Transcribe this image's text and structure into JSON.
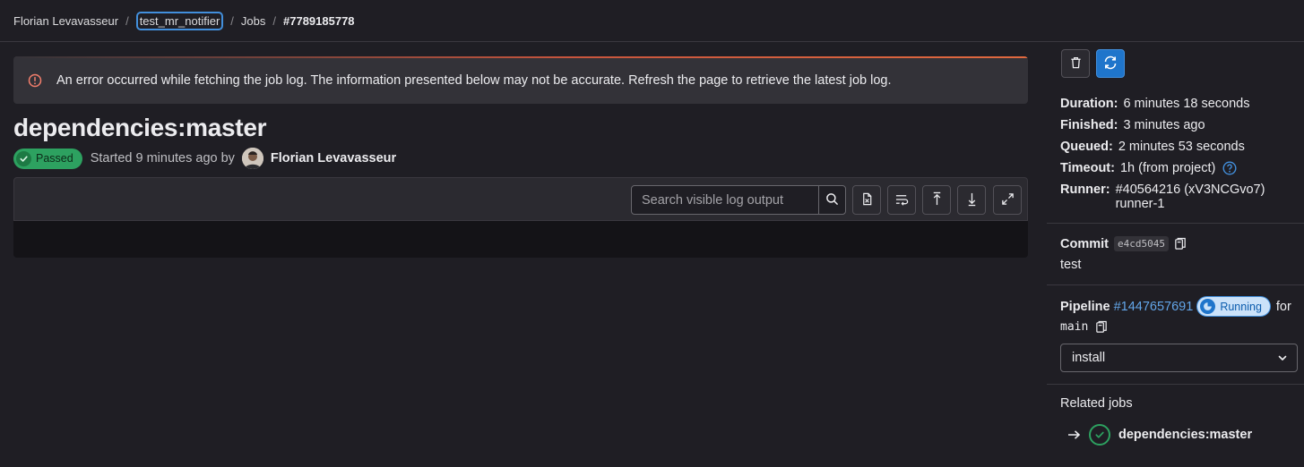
{
  "breadcrumb": {
    "items": [
      "Florian Levavasseur",
      "test_mr_notifier",
      "Jobs",
      "#7789185778"
    ],
    "separator": "/"
  },
  "alert": {
    "message": "An error occurred while fetching the job log. The information presented below may not be accurate. Refresh the page to retrieve the latest job log.",
    "icon": "error-circle-icon"
  },
  "job": {
    "title": "dependencies:master",
    "status": "Passed",
    "started_text": "Started 9 minutes ago by",
    "author": "Florian Levavasseur"
  },
  "log_toolbar": {
    "search_placeholder": "Search visible log output",
    "icons": [
      "search-icon",
      "raw-log-icon",
      "wrap-lines-icon",
      "scroll-to-top-icon",
      "scroll-to-bottom-icon",
      "fullscreen-icon"
    ]
  },
  "sidebar": {
    "actions": {
      "delete_icon": "trash-icon",
      "retry_icon": "retry-icon"
    },
    "details": [
      {
        "key": "Duration:",
        "value": "6 minutes 18 seconds"
      },
      {
        "key": "Finished:",
        "value": "3 minutes ago"
      },
      {
        "key": "Queued:",
        "value": "2 minutes 53 seconds"
      },
      {
        "key": "Timeout:",
        "value": "1h (from project)"
      },
      {
        "key": "Runner:",
        "value": "#40564216 (xV3NCGvo7)",
        "value2": "runner-1"
      }
    ],
    "commit": {
      "label": "Commit",
      "sha": "e4cd5045",
      "message": "test"
    },
    "pipeline": {
      "label": "Pipeline",
      "id": "#1447657691",
      "status": "Running",
      "for_text": "for",
      "ref": "main"
    },
    "stage_select": {
      "value": "install"
    },
    "related_jobs": {
      "label": "Related jobs",
      "job_name": "dependencies:master"
    }
  },
  "colors": {
    "accent": "#1f75cb",
    "success": "#2da160",
    "link": "#63a6e9",
    "background": "#1f1e24"
  }
}
